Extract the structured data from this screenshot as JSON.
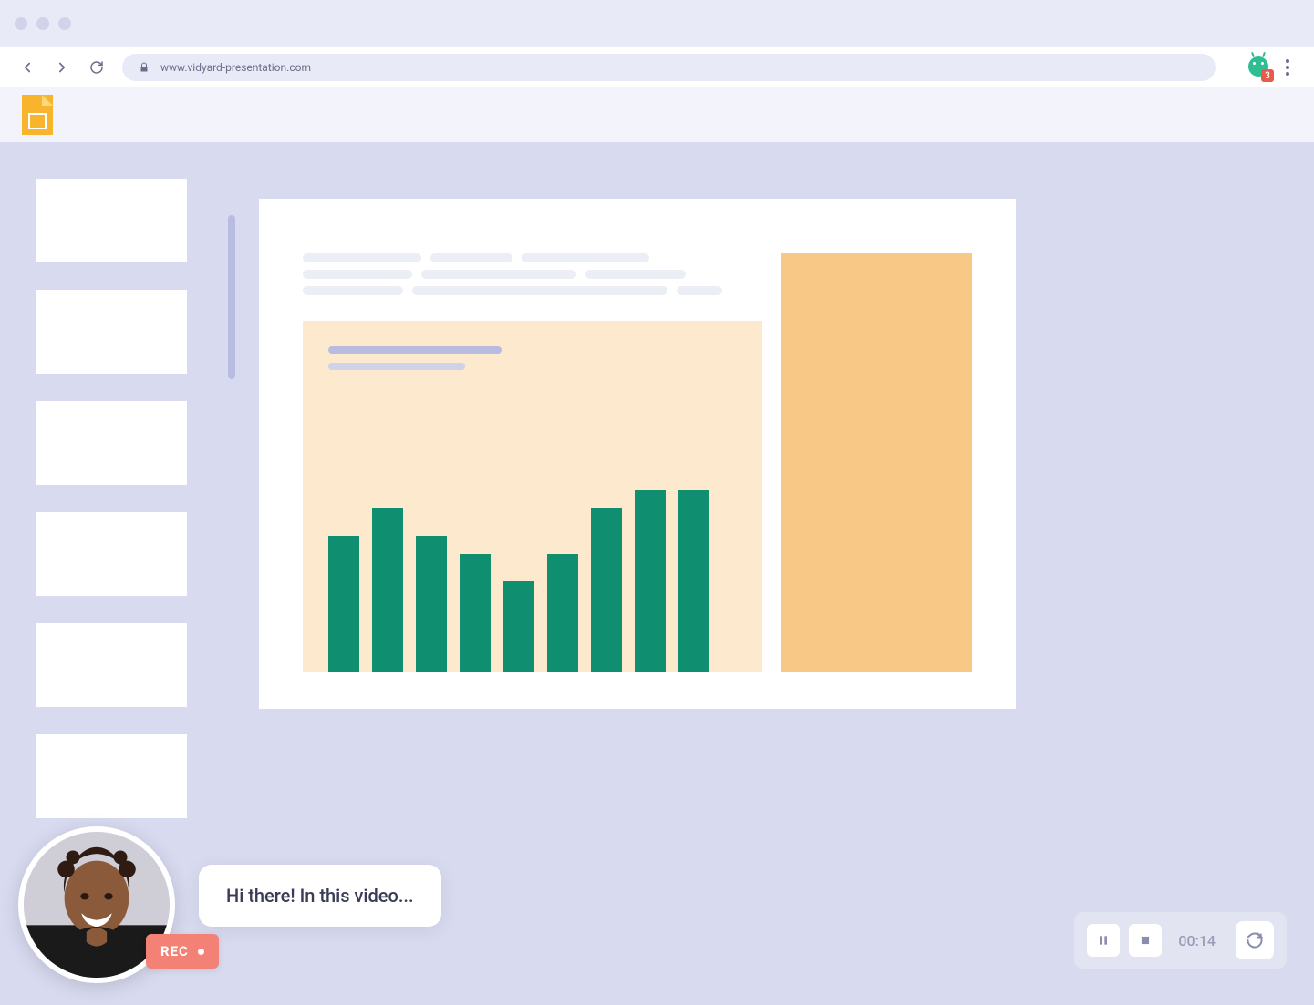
{
  "browser": {
    "url": "www.vidyard-presentation.com",
    "extension_badge": "3"
  },
  "thumbnails": {
    "count": 6
  },
  "caption": "Hi there! In this video...",
  "rec_label": "REC",
  "controls": {
    "time": "00:14"
  },
  "chart_data": {
    "type": "bar",
    "values": [
      75,
      90,
      75,
      65,
      50,
      65,
      90,
      100,
      100
    ],
    "ylim": [
      0,
      100
    ]
  },
  "placeholder_widths": [
    130,
    90,
    140,
    120,
    170,
    110,
    110,
    280,
    50
  ]
}
